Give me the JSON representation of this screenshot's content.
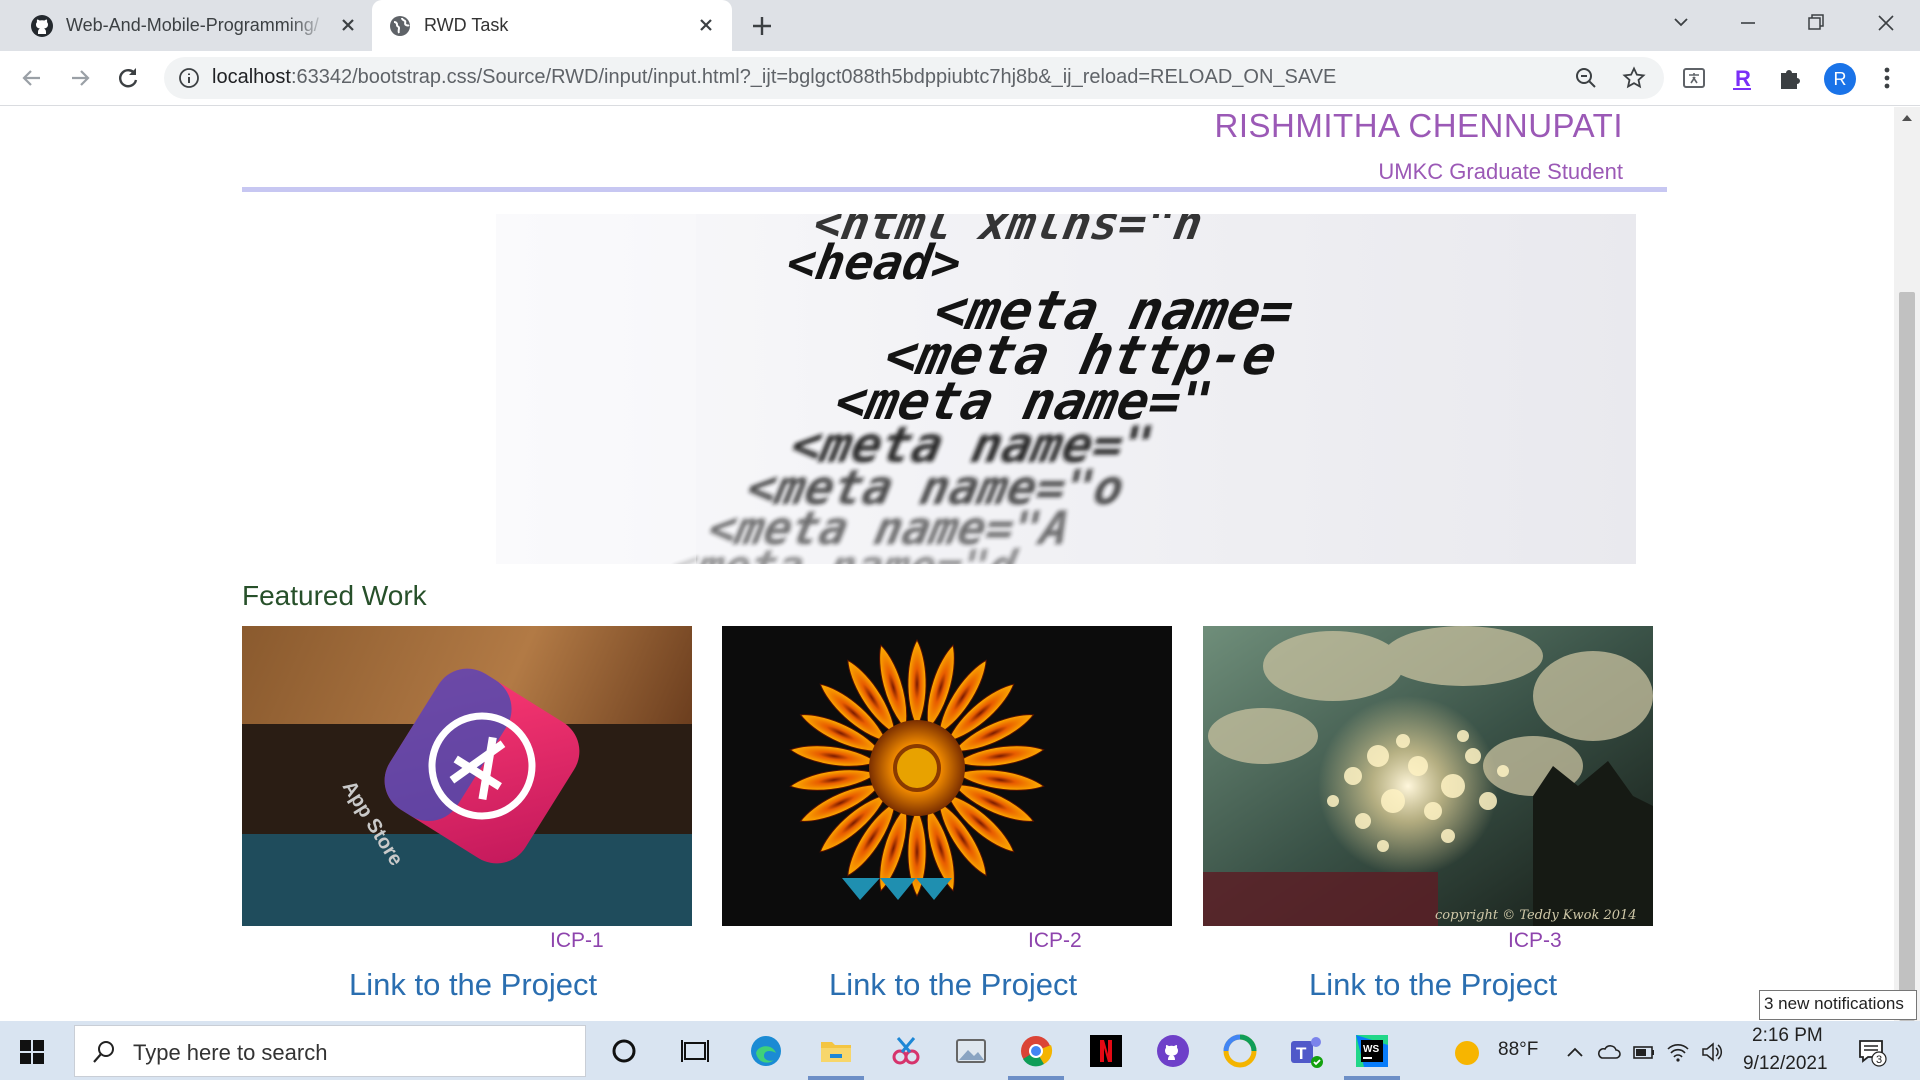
{
  "browser": {
    "tabs": [
      {
        "title": "Web-And-Mobile-Programming/"
      },
      {
        "title": "RWD Task"
      }
    ],
    "url_host": "localhost",
    "url_rest": ":63342/bootstrap.css/Source/RWD/input/input.html?_ijt=bglgct088th5bdppiubtc7hj8b&_ij_reload=RELOAD_ON_SAVE",
    "profile_initial": "R"
  },
  "page": {
    "name": "RISHMITHA CHENNUPATI",
    "subtitle": "UMKC Graduate Student",
    "hero_code_lines": [
      "<html xmlns=\"h",
      "<head>",
      "<meta name=",
      "<meta http-e",
      "<meta name=\"",
      "<meta name=\"",
      "<meta name=\"o",
      "<meta name=\"A",
      "<meta name=\"d"
    ],
    "featured_heading": "Featured Work",
    "projects": [
      {
        "label": "ICP-1",
        "link": "Link to the Project"
      },
      {
        "label": "ICP-2",
        "link": "Link to the Project"
      },
      {
        "label": "ICP-3",
        "link": "Link to the Project"
      }
    ],
    "card1_badge": "App Store",
    "card3_watermark": "copyright © Teddy Kwok 2014"
  },
  "notification": {
    "text": "3 new notifications"
  },
  "taskbar": {
    "search_placeholder": "Type here to search",
    "weather": "88°F",
    "time": "2:16 PM",
    "date": "9/12/2021",
    "notification_count": "3"
  },
  "colors": {
    "accent_purple": "#9b59b6",
    "link_blue": "#2a6eb0",
    "rule": "#c7c7f2",
    "heading_green": "#27502a"
  }
}
